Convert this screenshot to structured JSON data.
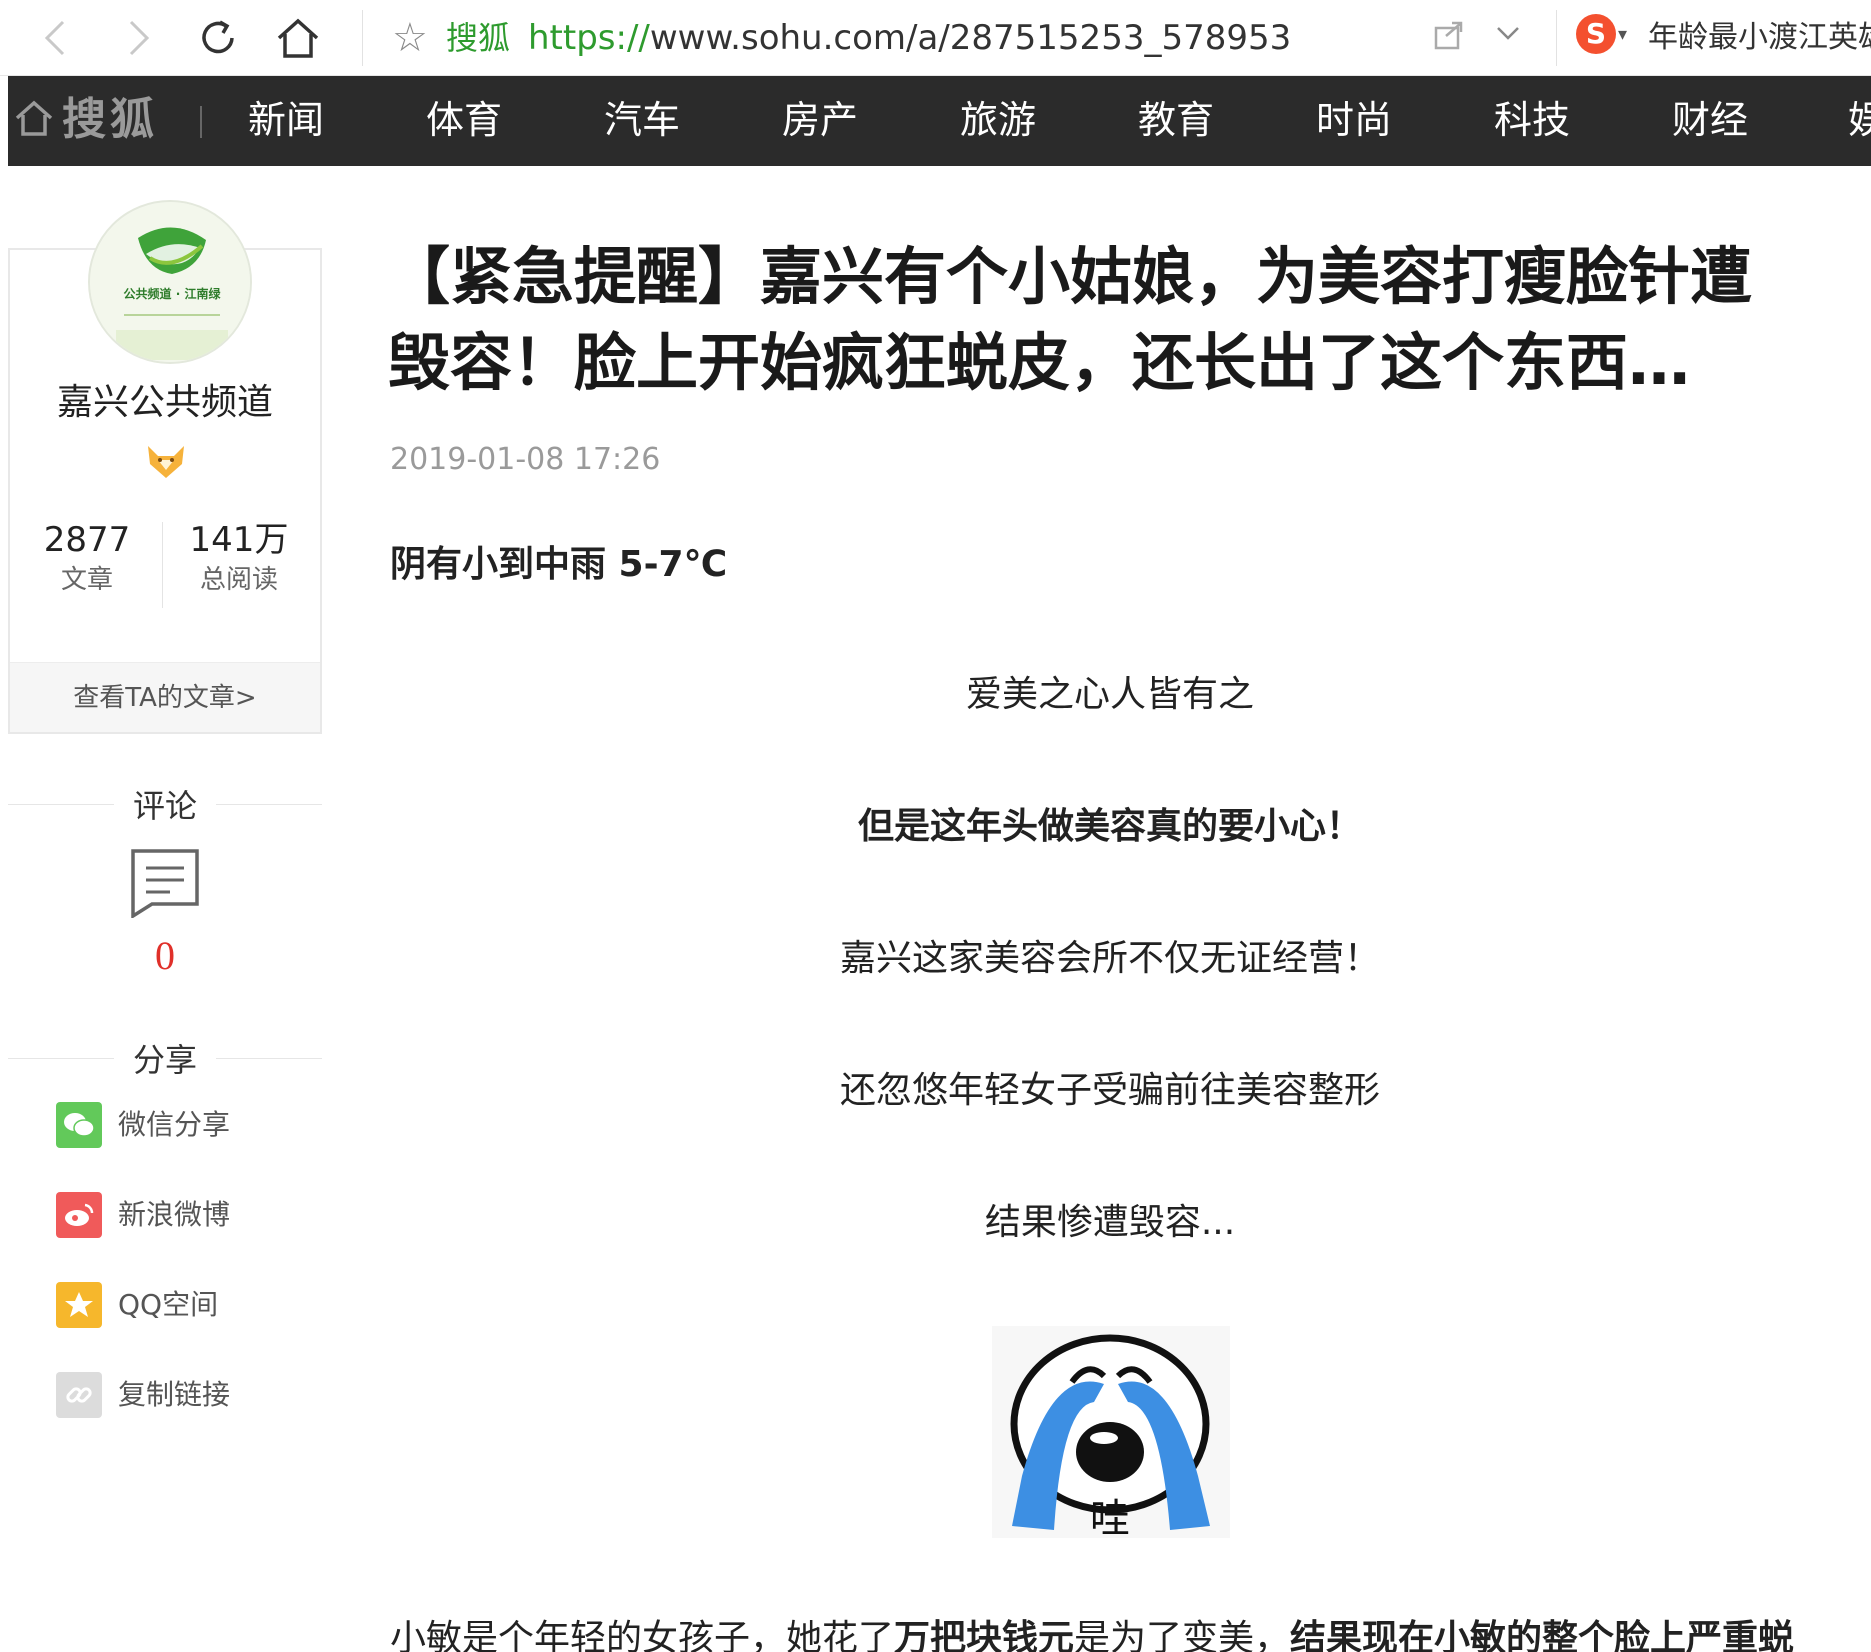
{
  "browser": {
    "site_name": "搜狐",
    "url_scheme": "https://",
    "url_rest": "www.sohu.com/a/287515253_578953",
    "hot_search": "年龄最小渡江英雄"
  },
  "nav": {
    "brand": "搜狐",
    "items": [
      "新闻",
      "体育",
      "汽车",
      "房产",
      "旅游",
      "教育",
      "时尚",
      "科技",
      "财经",
      "娱"
    ]
  },
  "author": {
    "name": "嘉兴公共频道",
    "articles_count": "2877",
    "articles_label": "文章",
    "reads_count": "141万",
    "reads_label": "总阅读",
    "view_link": "查看TA的文章>"
  },
  "comments": {
    "title": "评论",
    "count": "0"
  },
  "share": {
    "title": "分享",
    "items": [
      {
        "label": "微信分享",
        "icon": "wechat-icon",
        "color": "#62c95a"
      },
      {
        "label": "新浪微博",
        "icon": "weibo-icon",
        "color": "#f05a5a"
      },
      {
        "label": "QQ空间",
        "icon": "qzone-icon",
        "color": "#f6b72c"
      },
      {
        "label": "复制链接",
        "icon": "link-icon",
        "color": "#dcdcdc"
      }
    ]
  },
  "article": {
    "title": "【紧急提醒】嘉兴有个小姑娘，为美容打瘦脸针遭毁容！脸上开始疯狂蜕皮，还长出了这个东西…",
    "date": "2019-01-08 17:26",
    "weather": "阴有小到中雨 5-7℃",
    "paragraphs": [
      "爱美之心人皆有之",
      "但是这年头做美容真的要小心！",
      "嘉兴这家美容会所不仅无证经营！",
      "还忽悠年轻女子受骗前往美容整形",
      "结果惨遭毁容..."
    ],
    "meme_caption": "哇",
    "last_paragraph": {
      "part1": "小敏是个年轻的女孩子，她花了",
      "part2_bold": "万把块钱元",
      "part3": "是为了变美，",
      "part4_bold": "结果现在小敏的整个脸上严重蜕"
    }
  },
  "colors": {
    "nav_bg": "#2b2b2b",
    "link_green": "#2e9b2e",
    "comment_red": "#e0302a"
  }
}
